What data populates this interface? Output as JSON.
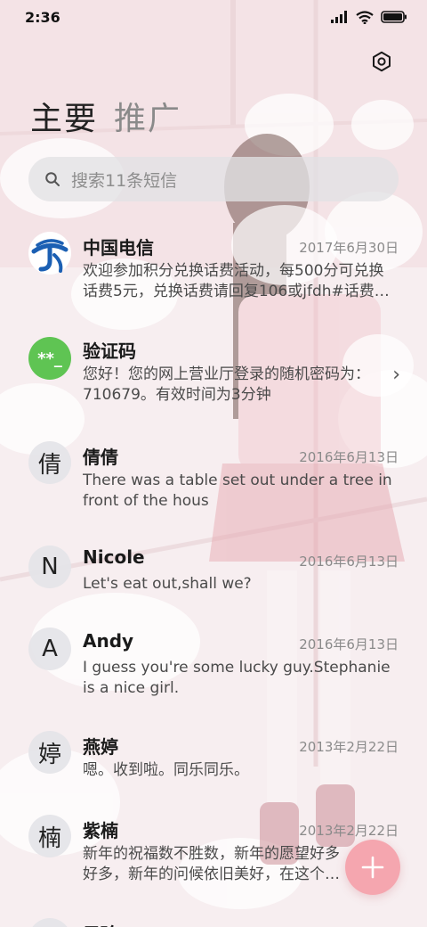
{
  "status_bar": {
    "time": "2:36"
  },
  "tabs": [
    {
      "label": "主要",
      "active": true
    },
    {
      "label": "推广",
      "active": false
    }
  ],
  "search": {
    "placeholder": "搜索11条短信"
  },
  "conversations": [
    {
      "name": "中国电信",
      "date": "2017年6月30日",
      "preview": "欢迎参加积分兑换话费活动，每500分可兑换话费5元，兑换话费请回复106或jfdh#话费…",
      "avatar_type": "telecom-logo"
    },
    {
      "name": "验证码",
      "date": "",
      "preview": "您好！您的网上营业厅登录的随机密码为：710679。有效时间为3分钟",
      "avatar_type": "verification",
      "avatar_text": "**_"
    },
    {
      "name": "倩倩",
      "date": "2016年6月13日",
      "preview": "There was a table set out under a tree in front of the hous",
      "avatar_text": "倩"
    },
    {
      "name": "Nicole",
      "date": "2016年6月13日",
      "preview": "Let's eat out,shall we?",
      "avatar_text": "N"
    },
    {
      "name": "Andy",
      "date": "2016年6月13日",
      "preview": "I guess you're some lucky guy.Stephanie is a nice girl.",
      "avatar_text": "A"
    },
    {
      "name": "燕婷",
      "date": "2013年2月22日",
      "preview": "嗯。收到啦。同乐同乐。",
      "avatar_text": "婷"
    },
    {
      "name": "紫楠",
      "date": "2013年2月22日",
      "preview": "新年的祝福数不胜数，新年的愿望好多好多，新年的问候依旧美好，在这个温馨的时",
      "avatar_text": "楠"
    },
    {
      "name": "子玲",
      "date": "",
      "preview": "",
      "avatar_text": ""
    }
  ],
  "colors": {
    "accent_fab": "#f4969f",
    "telecom_blue": "#1b5fb3",
    "verification_green": "#5fc453"
  },
  "icons": {
    "settings": "settings-icon",
    "search": "search-icon",
    "fab": "plus-icon",
    "chevron": "chevron-right-icon"
  }
}
